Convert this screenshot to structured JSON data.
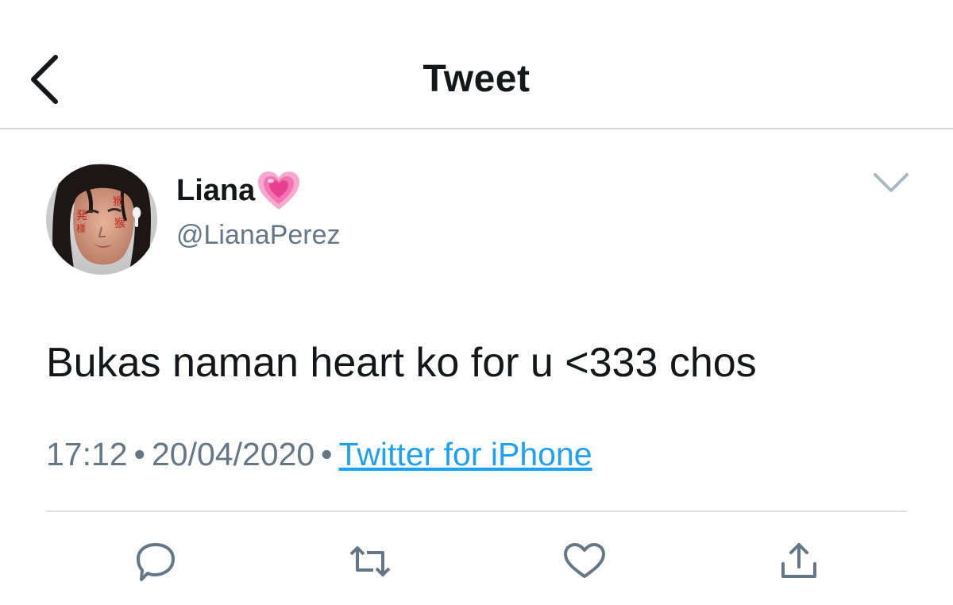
{
  "header": {
    "title": "Tweet",
    "back_icon": "chevron-left-icon"
  },
  "author": {
    "display_name": "Liana",
    "name_emoji": "growing-heart-icon",
    "handle": "@LianaPerez",
    "avatar_icon": "avatar"
  },
  "tweet": {
    "text": "Bukas naman heart ko for u <333 chos",
    "time": "17:12",
    "date": "20/04/2020",
    "separator": "•",
    "source": "Twitter for iPhone"
  },
  "actions": [
    {
      "icon": "reply-icon"
    },
    {
      "icon": "retweet-icon"
    },
    {
      "icon": "like-icon"
    },
    {
      "icon": "share-icon"
    }
  ],
  "colors": {
    "accent": "#1da1f2",
    "icon_gray": "#657786",
    "text": "#14171a",
    "divider": "#dee1e4",
    "heart_pink": "#f25fa4"
  }
}
